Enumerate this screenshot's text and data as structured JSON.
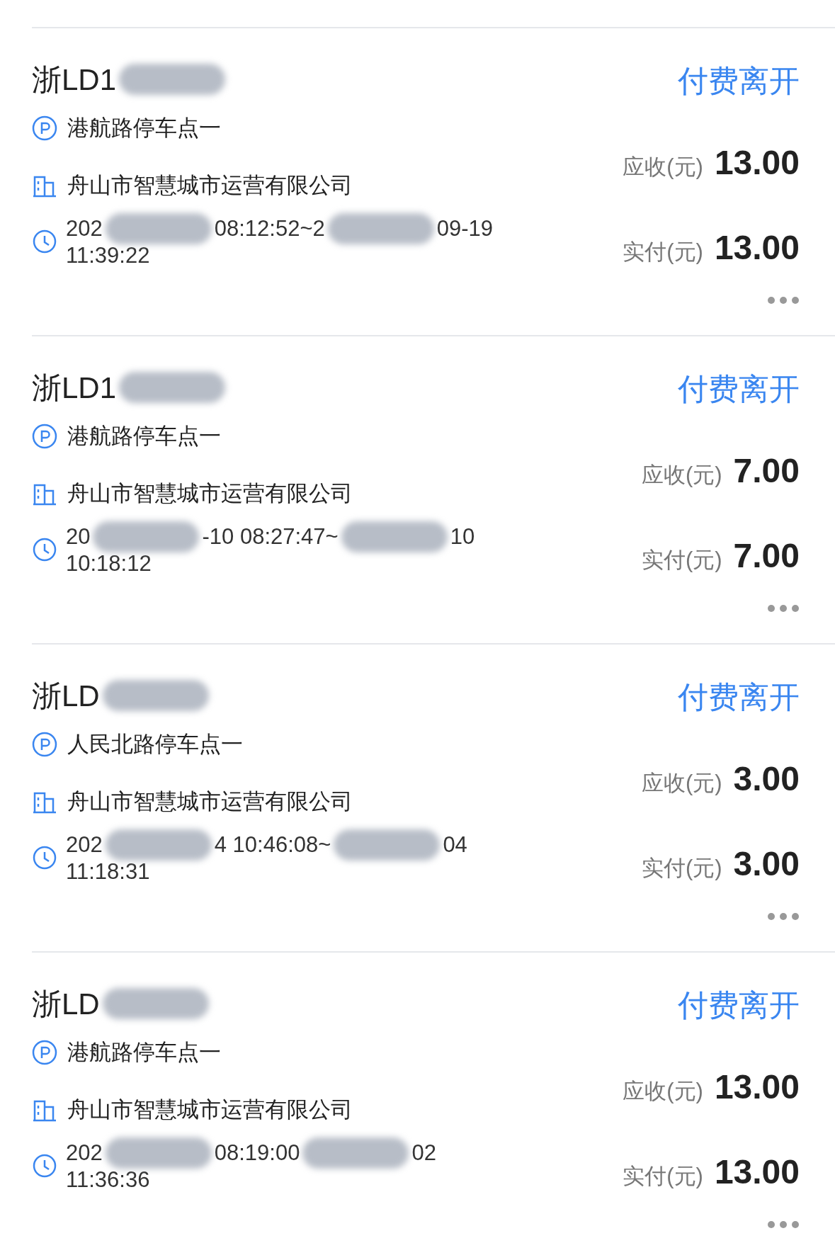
{
  "records": [
    {
      "plate": "浙LD1",
      "action": "付费离开",
      "location": "港航路停车点一",
      "company": "舟山市智慧城市运营有限公司",
      "time_parts": [
        "202",
        "08:12:52~2",
        "09-19"
      ],
      "time_end": "11:39:22",
      "receivable_label": "应收(元)",
      "receivable": "13.00",
      "paid_label": "实付(元)",
      "paid": "13.00"
    },
    {
      "plate": "浙LD1",
      "action": "付费离开",
      "location": "港航路停车点一",
      "company": "舟山市智慧城市运营有限公司",
      "time_parts": [
        "20",
        "-10 08:27:47~",
        "10"
      ],
      "time_end": "10:18:12",
      "receivable_label": "应收(元)",
      "receivable": "7.00",
      "paid_label": "实付(元)",
      "paid": "7.00"
    },
    {
      "plate": "浙LD",
      "action": "付费离开",
      "location": "人民北路停车点一",
      "company": "舟山市智慧城市运营有限公司",
      "time_parts": [
        "202",
        "4 10:46:08~",
        "04"
      ],
      "time_end": "11:18:31",
      "receivable_label": "应收(元)",
      "receivable": "3.00",
      "paid_label": "实付(元)",
      "paid": "3.00"
    },
    {
      "plate": "浙LD",
      "action": "付费离开",
      "location": "港航路停车点一",
      "company": "舟山市智慧城市运营有限公司",
      "time_parts": [
        "202",
        "08:19:00",
        "02"
      ],
      "time_end": "11:36:36",
      "receivable_label": "应收(元)",
      "receivable": "13.00",
      "paid_label": "实付(元)",
      "paid": "13.00"
    }
  ]
}
